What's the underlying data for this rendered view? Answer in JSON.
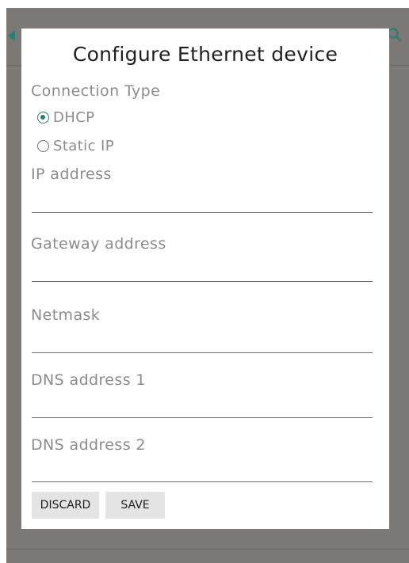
{
  "dialog": {
    "title": "Configure Ethernet device",
    "connection_type_label": "Connection Type",
    "options": [
      {
        "label": "DHCP",
        "selected": true
      },
      {
        "label": "Static IP",
        "selected": false
      }
    ],
    "fields": [
      {
        "label": "IP address",
        "value": ""
      },
      {
        "label": "Gateway address",
        "value": ""
      },
      {
        "label": "Netmask",
        "value": ""
      },
      {
        "label": "DNS address 1",
        "value": ""
      },
      {
        "label": "DNS address 2",
        "value": ""
      }
    ],
    "buttons": {
      "discard": "DISCARD",
      "save": "SAVE"
    }
  },
  "colors": {
    "accent": "#2c7d72",
    "scrim": "#7b7876",
    "button_bg": "#e4e4e4"
  },
  "icons": {
    "back": "back-arrow-icon",
    "search": "search-icon"
  }
}
